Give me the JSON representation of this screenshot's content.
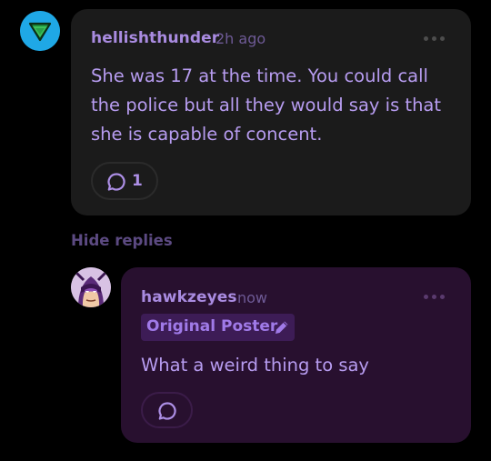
{
  "thread": {
    "comment": {
      "username": "hellishthunder",
      "timestamp": "2h ago",
      "avatar_icon": "cone-triangle-icon",
      "text_lines": [
        "She was 17 at the time. You could call",
        "the police but all they would say is that",
        "she is capable of concent."
      ],
      "reply_count": "1",
      "more_icon": "more-horizontal-icon"
    },
    "hide_replies_label": "Hide replies",
    "reply": {
      "username": "hawkzeyes",
      "timestamp": "now",
      "avatar_icon": "hawkeye-avatar",
      "badge_label": "Original Poster",
      "badge_icon": "pencil-icon",
      "text": "What a weird thing to say",
      "more_icon": "more-horizontal-icon"
    }
  },
  "colors": {
    "background": "#000000",
    "comment_card": "#1b1b1b",
    "reply_card": "#28102f",
    "accent": "#b79cf0",
    "username": "#a98be0",
    "badge_bg": "#3d1c56",
    "avatar_blue": "#1fa8e6"
  }
}
